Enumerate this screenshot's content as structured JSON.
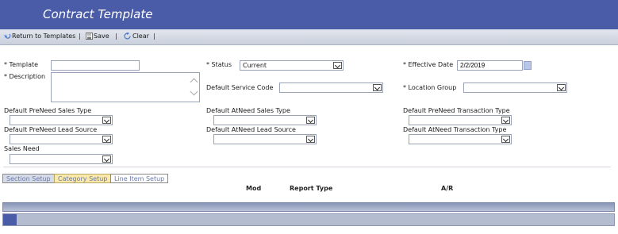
{
  "header": {
    "title": "Contract Template"
  },
  "toolbar": {
    "return_label": "Return to Templates",
    "save_label": "Save",
    "clear_label": "Clear",
    "separator": "|"
  },
  "form": {
    "template_label": "* Template",
    "template_value": "",
    "description_label": "* Description",
    "description_value": "",
    "status_label": "* Status",
    "status_value": "Current",
    "service_code_label": "Default Service Code",
    "service_code_value": "",
    "effective_date_label": "* Effective Date",
    "effective_date_value": "2/2/2019",
    "location_group_label": "* Location Group",
    "location_group_value": "",
    "preneed_sales_type_label": "Default PreNeed Sales Type",
    "atneed_sales_type_label": "Default AtNeed Sales Type",
    "preneed_transaction_type_label": "Default PreNeed Transaction Type",
    "preneed_lead_source_label": "Default PreNeed Lead Source",
    "atneed_lead_source_label": "Default AtNeed Lead Source",
    "atneed_transaction_type_label": "Default AtNeed Transaction Type",
    "sales_need_label": "Sales Need"
  },
  "tabs": {
    "section": "Section Setup",
    "category": "Category Setup",
    "line_item": "Line Item Setup"
  },
  "grid": {
    "columns": [
      "Mod",
      "Report Type",
      "A/R"
    ]
  },
  "colors": {
    "header_bg": "#4a5ca8",
    "toolbar_bg": "#d3d9e4",
    "category_tab_bg": "#fbe9a8"
  }
}
